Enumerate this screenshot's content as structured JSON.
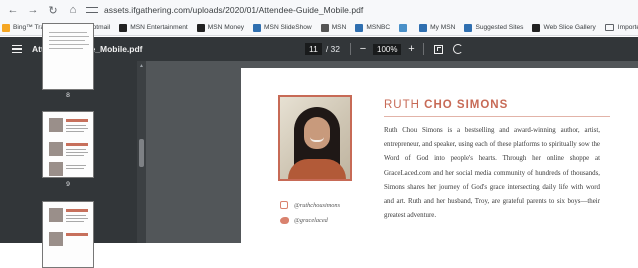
{
  "browser": {
    "url": "assets.ifgathering.com/uploads/2020/01/Attendee-Guide_Mobile.pdf",
    "bookmarks": [
      {
        "label": "Bing™ Traffic",
        "color": "#f5a623"
      },
      {
        "label": "Free Hotmail",
        "color": "#4aa3df"
      },
      {
        "label": "MSN Entertainment",
        "color": "#222222"
      },
      {
        "label": "MSN Money",
        "color": "#222222"
      },
      {
        "label": "MSN SlideShow",
        "color": "#2f6fb0"
      },
      {
        "label": "MSN",
        "color": "#555555"
      },
      {
        "label": "MSNBC",
        "color": "#2f6fb0"
      },
      {
        "label": "",
        "color": "#4a90c8"
      },
      {
        "label": "My MSN",
        "color": "#2f6fb0"
      },
      {
        "label": "Suggested Sites",
        "color": "#2f6fb0"
      },
      {
        "label": "Web Slice Gallery",
        "color": "#222222"
      },
      {
        "label": "Imported From IE",
        "color": "folder"
      }
    ]
  },
  "pdf": {
    "title": "Attendee-Guide_Mobile.pdf",
    "current_page": "11",
    "total_pages": "/ 32",
    "zoom": "100%"
  },
  "thumbnails": [
    {
      "number": "8"
    },
    {
      "number": "9"
    },
    {
      "number": ""
    }
  ],
  "page_content": {
    "name_first": "RUTH",
    "name_rest": "CHO SIMONS",
    "bio": "Ruth Chou Simons is a bestselling and award-winning author, artist, entrepreneur, and speaker, using each of these platforms to spiritually sow the Word of God into people's hearts. Through her online shoppe at GraceLaced.com and her social media community of hundreds of thousands, Simons shares her journey of God's grace intersecting daily life with word and art. Ruth and her husband, Troy, are grateful parents to six boys—their greatest adventure.",
    "instagram": "@ruthchousimons",
    "twitter": "@gracelaced"
  }
}
